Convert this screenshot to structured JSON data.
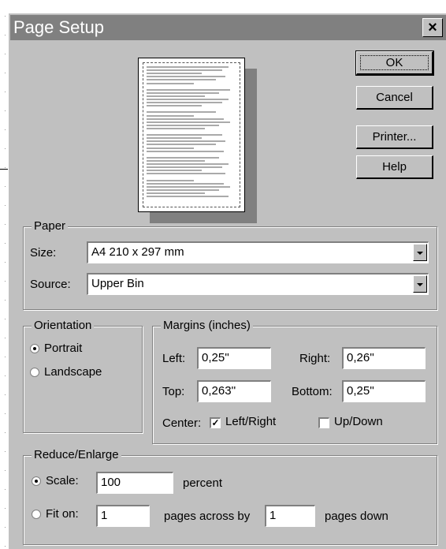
{
  "window": {
    "title": "Page Setup",
    "close_glyph": "×"
  },
  "buttons": {
    "ok": "OK",
    "cancel": "Cancel",
    "printer": "Printer...",
    "help": "Help"
  },
  "paper": {
    "legend": "Paper",
    "size_label": "Size:",
    "size_value": "A4 210 x 297 mm",
    "source_label": "Source:",
    "source_value": "Upper Bin"
  },
  "orientation": {
    "legend": "Orientation",
    "portrait": "Portrait",
    "landscape": "Landscape",
    "selected": "portrait"
  },
  "margins": {
    "legend": "Margins (inches)",
    "left_label": "Left:",
    "left_value": "0,25''",
    "right_label": "Right:",
    "right_value": "0,26''",
    "top_label": "Top:",
    "top_value": "0,263''",
    "bottom_label": "Bottom:",
    "bottom_value": "0,25''",
    "center_label": "Center:",
    "left_right_label": "Left/Right",
    "left_right_checked": true,
    "up_down_label": "Up/Down",
    "up_down_checked": false
  },
  "scaling": {
    "legend": "Reduce/Enlarge",
    "scale_label": "Scale:",
    "scale_value": "100",
    "percent": "percent",
    "fit_label": "Fit on:",
    "fit_across_value": "1",
    "pages_across_by": "pages across by",
    "fit_down_value": "1",
    "pages_down": "pages down",
    "selected": "scale"
  }
}
